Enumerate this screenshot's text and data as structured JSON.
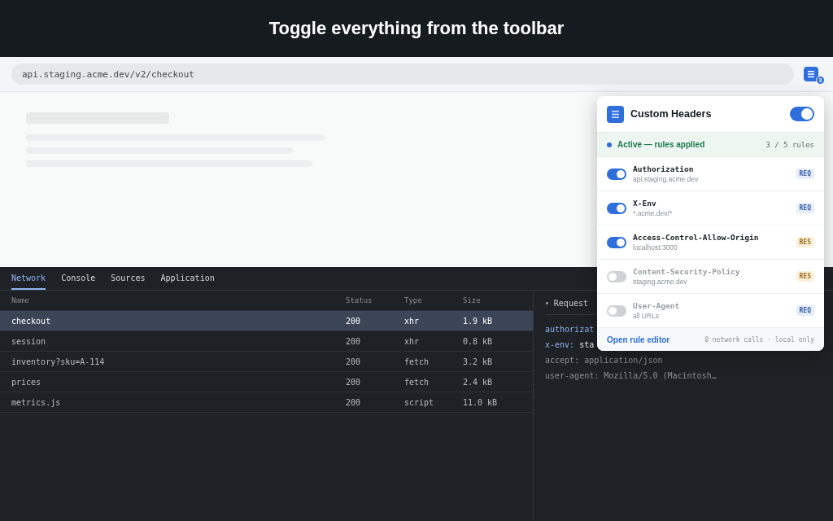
{
  "banner": {
    "title": "Toggle everything from the toolbar"
  },
  "browser": {
    "url": "api.staging.acme.dev/v2/checkout",
    "extension_badge": "3"
  },
  "popup": {
    "title": "Custom Headers",
    "enabled": true,
    "status": "Active — rules applied",
    "count": "3 / 5 rules",
    "rules": [
      {
        "name": "Authorization",
        "scope": "api.staging.acme.dev",
        "on": true,
        "kind": "req",
        "tag": "REQ"
      },
      {
        "name": "X-Env",
        "scope": "*.acme.dev/*",
        "on": true,
        "kind": "req",
        "tag": "REQ"
      },
      {
        "name": "Access-Control-Allow-Origin",
        "scope": "localhost:3000",
        "on": true,
        "kind": "res",
        "tag": "RES"
      },
      {
        "name": "Content-Security-Policy",
        "scope": "staging.acme.dev",
        "on": false,
        "kind": "res",
        "tag": "RES"
      },
      {
        "name": "User-Agent",
        "scope": "all URLs",
        "on": false,
        "kind": "req",
        "tag": "REQ"
      }
    ],
    "footer_link": "Open rule editor",
    "footer_note": "0 network calls · local only"
  },
  "devtools": {
    "tabs": [
      {
        "label": "Network",
        "selected": true
      },
      {
        "label": "Console",
        "selected": false
      },
      {
        "label": "Sources",
        "selected": false
      },
      {
        "label": "Application",
        "selected": false
      }
    ],
    "table": {
      "columns": [
        "Name",
        "Status",
        "Type",
        "Size"
      ],
      "rows": [
        {
          "cells": [
            "checkout",
            "200",
            "xhr",
            "1.9 kB"
          ],
          "selected": true
        },
        {
          "cells": [
            "session",
            "200",
            "xhr",
            "0.8 kB"
          ],
          "selected": false
        },
        {
          "cells": [
            "inventory?sku=A-114",
            "200",
            "fetch",
            "3.2 kB"
          ],
          "selected": false
        },
        {
          "cells": [
            "prices",
            "200",
            "fetch",
            "2.4 kB"
          ],
          "selected": false
        },
        {
          "cells": [
            "metrics.js",
            "200",
            "script",
            "11.0 kB"
          ],
          "selected": false
        }
      ]
    },
    "details": {
      "heading_marker": "▾",
      "heading": "Request",
      "lines": [
        {
          "key": "authorizat",
          "applied": true
        },
        {
          "key": "x-env:",
          "value": "sta",
          "applied": true
        },
        {
          "key": "accept:",
          "value": "application/json",
          "applied": false
        },
        {
          "key": "user-agent:",
          "value": "Mozilla/5.0 (Macintosh…",
          "applied": false
        }
      ]
    }
  }
}
